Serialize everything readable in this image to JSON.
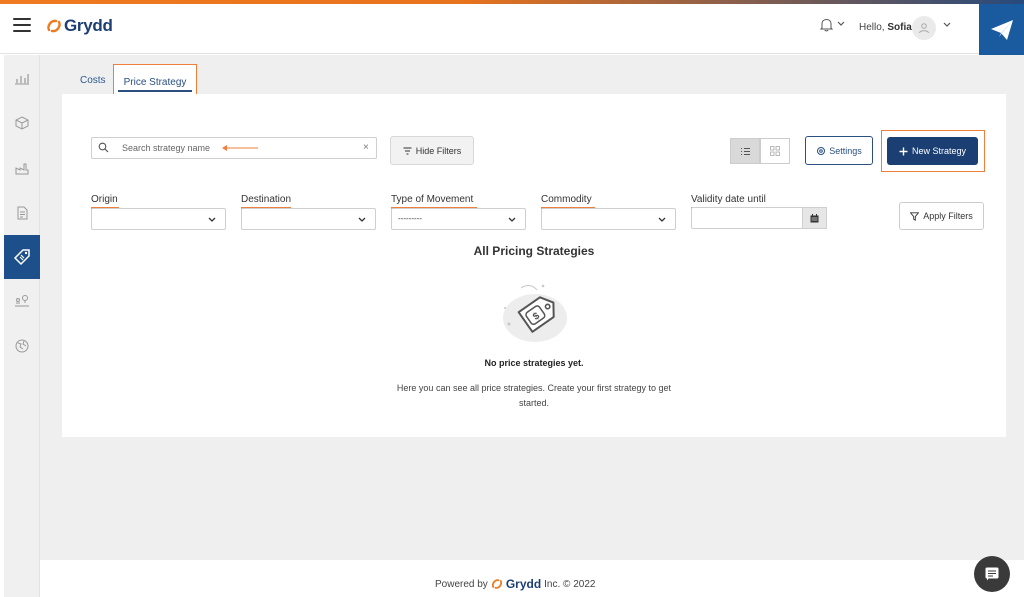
{
  "brand": {
    "name": "Grydd"
  },
  "header": {
    "greeting_prefix": "Hello,",
    "user_name": "Sofia"
  },
  "tabs": [
    {
      "label": "Costs"
    },
    {
      "label": "Price Strategy",
      "active": true
    }
  ],
  "toolbar": {
    "search_placeholder": "Search strategy name",
    "clear_symbol": "×",
    "hide_filters_label": "Hide Filters",
    "settings_label": "Settings",
    "new_strategy_label": "New Strategy"
  },
  "filters": {
    "origin": {
      "label": "Origin",
      "value": ""
    },
    "destination": {
      "label": "Destination",
      "value": ""
    },
    "type_of_movement": {
      "label": "Type of Movement",
      "value": "---------"
    },
    "commodity": {
      "label": "Commodity",
      "value": ""
    },
    "validity_date": {
      "label": "Validity date until",
      "value": ""
    },
    "apply_label": "Apply Filters"
  },
  "list": {
    "title": "All Pricing Strategies",
    "empty_title": "No price strategies yet.",
    "empty_description": "Here you can see all price strategies. Create your first strategy to get started."
  },
  "footer": {
    "prefix": "Powered by",
    "brand": "Grydd",
    "suffix": "Inc. © 2022"
  },
  "colors": {
    "brand_navy": "#1b3f73",
    "accent_orange": "#ef7f3a",
    "sidebar_active": "#1d4f8a"
  },
  "icons": [
    "menu-icon",
    "bell-icon",
    "chevron-down-icon",
    "user-icon",
    "send-icon",
    "chart-icon",
    "box-icon",
    "factory-icon",
    "document-icon",
    "price-tag-icon",
    "map-pin-icon",
    "globe-icon",
    "search-icon",
    "filter-icon",
    "list-view-icon",
    "grid-view-icon",
    "gear-icon",
    "plus-icon",
    "calendar-icon",
    "funnel-icon",
    "chat-icon"
  ]
}
